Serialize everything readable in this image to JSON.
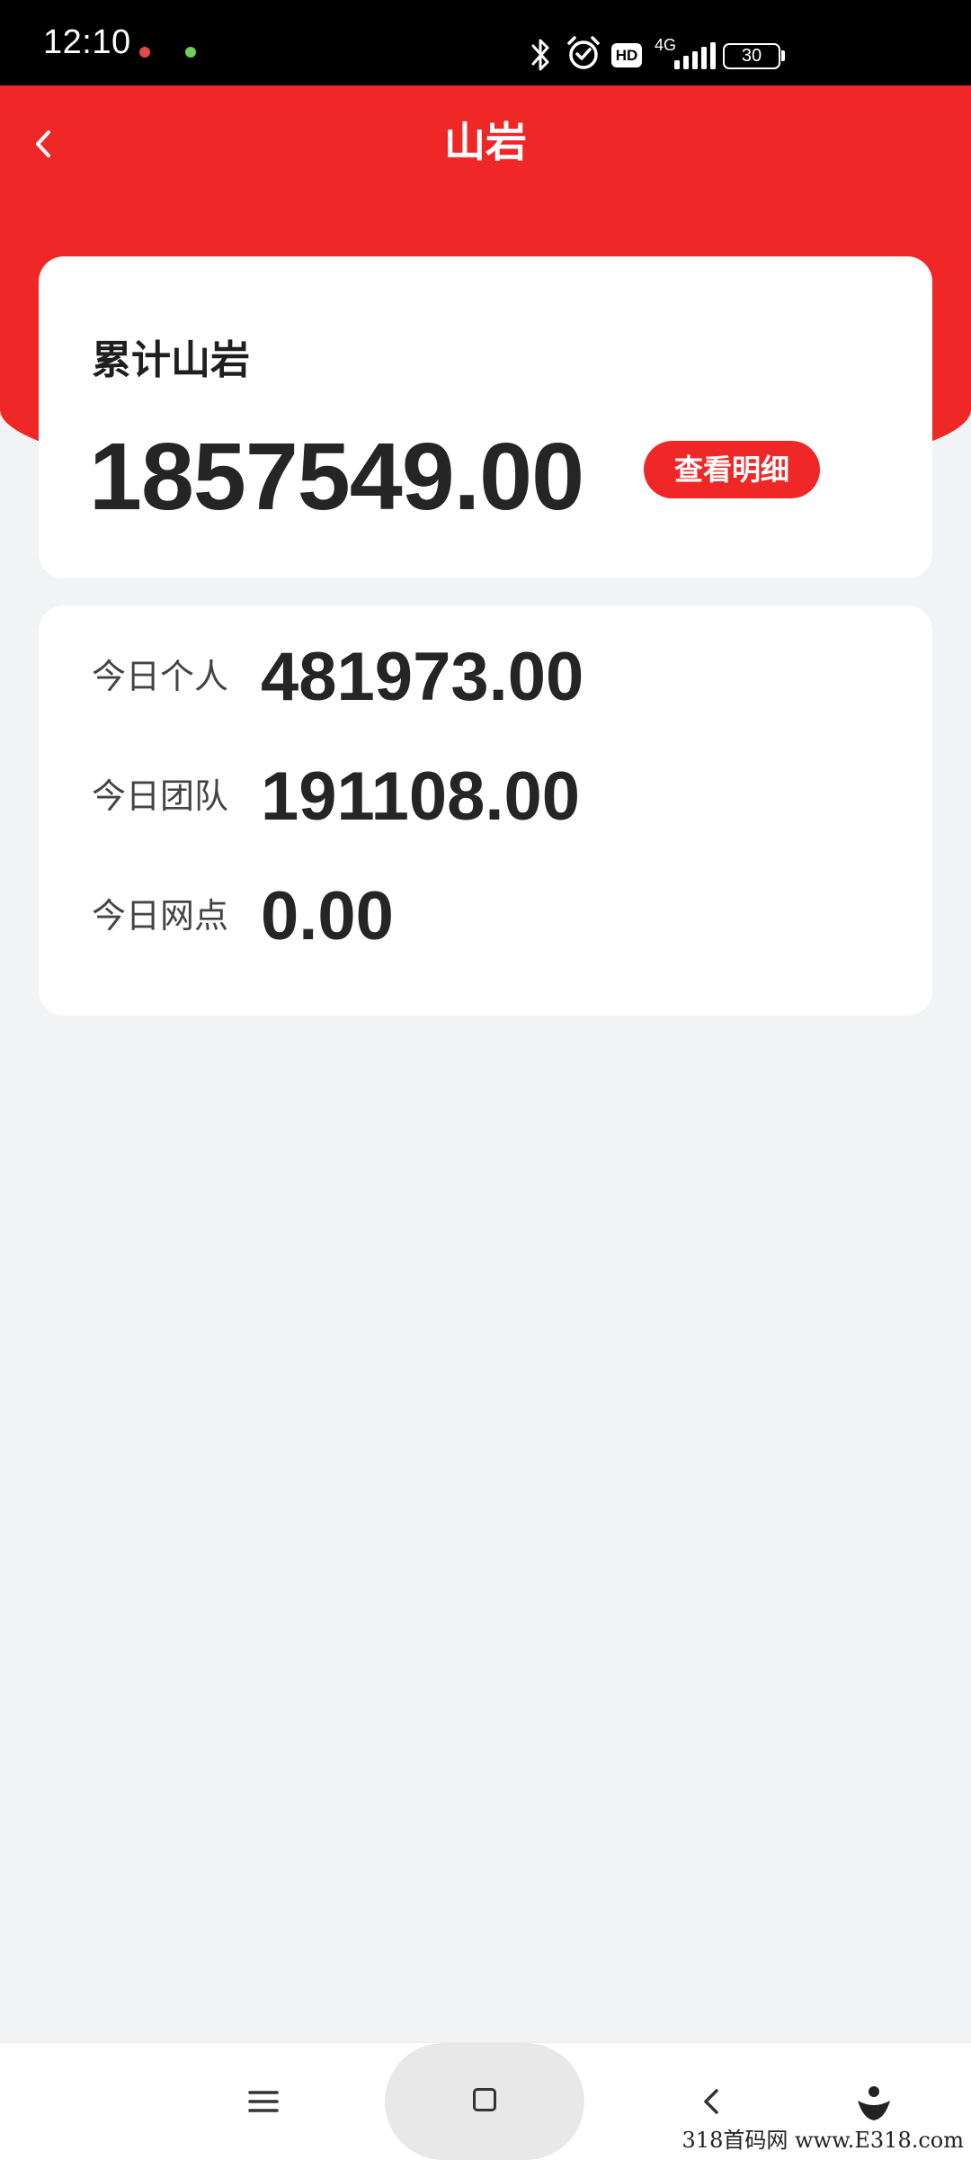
{
  "status_bar": {
    "time": "12:10",
    "network": "4G",
    "hd": "HD",
    "battery": "30"
  },
  "header": {
    "title": "山岩"
  },
  "total_card": {
    "label": "累计山岩",
    "value": "1857549.00",
    "detail_button": "查看明细"
  },
  "today_card": {
    "rows": [
      {
        "label": "今日个人",
        "value": "481973.00"
      },
      {
        "label": "今日团队",
        "value": "191108.00"
      },
      {
        "label": "今日网点",
        "value": "0.00"
      }
    ]
  },
  "watermark": "318首码网 www.E318.com",
  "colors": {
    "brand_red": "#ef2726",
    "background": "#f2f3f5",
    "card": "#ffffff"
  },
  "icons": {
    "back": "chevron-left-icon",
    "nav_menu": "menu-icon",
    "nav_home": "home-square-icon",
    "nav_back": "chevron-left-icon",
    "nav_assistant": "assistant-icon"
  }
}
